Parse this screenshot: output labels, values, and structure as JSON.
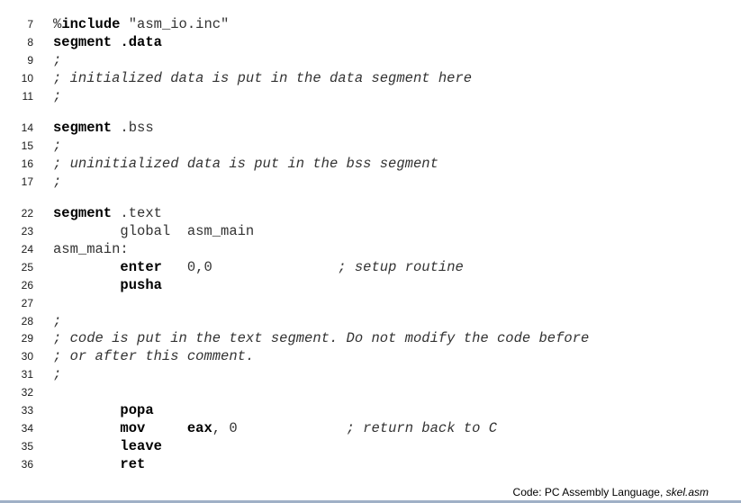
{
  "listing": {
    "lines": [
      {
        "number": "7",
        "tokens": [
          {
            "t": "%",
            "s": "tx"
          },
          {
            "t": "include",
            "s": "kw"
          },
          {
            "t": " \"asm_io.inc\"",
            "s": "tx"
          }
        ]
      },
      {
        "number": "8",
        "tokens": [
          {
            "t": "segment",
            "s": "kw"
          },
          {
            "t": " ",
            "s": "tx"
          },
          {
            "t": ".data",
            "s": "kw"
          }
        ]
      },
      {
        "number": "9",
        "tokens": [
          {
            "t": ";",
            "s": "cm"
          }
        ]
      },
      {
        "number": "10",
        "tokens": [
          {
            "t": "; initialized data is put in the data segment here",
            "s": "cm"
          }
        ]
      },
      {
        "number": "11",
        "tokens": [
          {
            "t": ";",
            "s": "cm"
          }
        ]
      },
      {
        "number": "14",
        "tokens": [
          {
            "t": "segment",
            "s": "kw"
          },
          {
            "t": " .bss",
            "s": "tx"
          }
        ]
      },
      {
        "number": "15",
        "tokens": [
          {
            "t": ";",
            "s": "cm"
          }
        ]
      },
      {
        "number": "16",
        "tokens": [
          {
            "t": "; uninitialized data is put in the bss segment",
            "s": "cm"
          }
        ]
      },
      {
        "number": "17",
        "tokens": [
          {
            "t": ";",
            "s": "cm"
          }
        ]
      },
      {
        "number": "22",
        "tokens": [
          {
            "t": "segment",
            "s": "kw"
          },
          {
            "t": " .text",
            "s": "tx"
          }
        ]
      },
      {
        "number": "23",
        "tokens": [
          {
            "t": "        global  asm_main",
            "s": "tx"
          }
        ]
      },
      {
        "number": "24",
        "tokens": [
          {
            "t": "asm_main:",
            "s": "tx"
          }
        ]
      },
      {
        "number": "25",
        "tokens": [
          {
            "t": "        ",
            "s": "tx"
          },
          {
            "t": "enter",
            "s": "kw"
          },
          {
            "t": "   0,0               ",
            "s": "tx"
          },
          {
            "t": "; setup routine",
            "s": "cm"
          }
        ]
      },
      {
        "number": "26",
        "tokens": [
          {
            "t": "        ",
            "s": "tx"
          },
          {
            "t": "pusha",
            "s": "kw"
          }
        ]
      },
      {
        "number": "27",
        "tokens": []
      },
      {
        "number": "28",
        "tokens": [
          {
            "t": ";",
            "s": "cm"
          }
        ]
      },
      {
        "number": "29",
        "tokens": [
          {
            "t": "; code is put in the text segment. Do not modify the code before",
            "s": "cm"
          }
        ]
      },
      {
        "number": "30",
        "tokens": [
          {
            "t": "; or after this comment.",
            "s": "cm"
          }
        ]
      },
      {
        "number": "31",
        "tokens": [
          {
            "t": ";",
            "s": "cm"
          }
        ]
      },
      {
        "number": "32",
        "tokens": []
      },
      {
        "number": "33",
        "tokens": [
          {
            "t": "        ",
            "s": "tx"
          },
          {
            "t": "popa",
            "s": "kw"
          }
        ]
      },
      {
        "number": "34",
        "tokens": [
          {
            "t": "        ",
            "s": "tx"
          },
          {
            "t": "mov",
            "s": "kw"
          },
          {
            "t": "     ",
            "s": "tx"
          },
          {
            "t": "eax",
            "s": "kw"
          },
          {
            "t": ", 0             ",
            "s": "tx"
          },
          {
            "t": "; return back to C",
            "s": "cm"
          }
        ]
      },
      {
        "number": "35",
        "tokens": [
          {
            "t": "        ",
            "s": "tx"
          },
          {
            "t": "leave",
            "s": "kw"
          }
        ]
      },
      {
        "number": "36",
        "tokens": [
          {
            "t": "        ",
            "s": "tx"
          },
          {
            "t": "ret",
            "s": "kw"
          }
        ]
      }
    ]
  },
  "caption": {
    "prefix": "Code: PC Assembly Language, ",
    "filename": "skel.asm"
  },
  "colors": {
    "bottom_rule": "#9fb0c6"
  }
}
